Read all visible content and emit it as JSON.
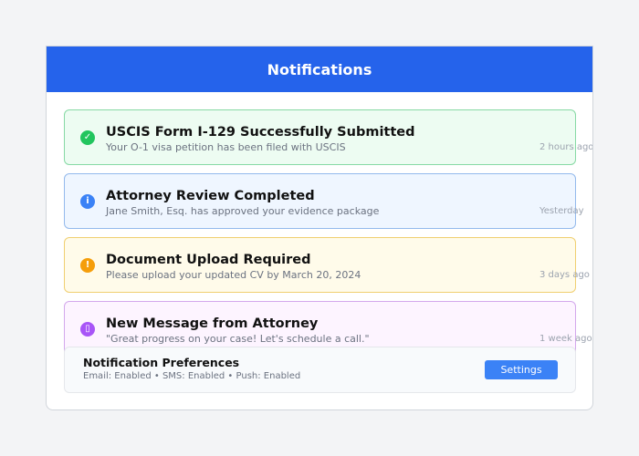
{
  "header": {
    "title": "Notifications"
  },
  "notifications": [
    {
      "title": "USCIS Form I-129 Successfully Submitted",
      "description": "Your O-1 visa petition has been filed with USCIS",
      "time": "2 hours ago",
      "icon": "check-icon",
      "icon_glyph": "✓",
      "bg": "#edfcf2",
      "border": "#86d9a4",
      "icon_color": "#22c55e"
    },
    {
      "title": "Attorney Review Completed",
      "description": "Jane Smith, Esq. has approved your evidence package",
      "time": "Yesterday",
      "icon": "info-icon",
      "icon_glyph": "i",
      "bg": "#eff6ff",
      "border": "#93b9ec",
      "icon_color": "#3b82f6"
    },
    {
      "title": "Document Upload Required",
      "description": "Please upload your updated CV by March 20, 2024",
      "time": "3 days ago",
      "icon": "warning-icon",
      "icon_glyph": "!",
      "bg": "#fffbea",
      "border": "#f0cf70",
      "icon_color": "#f59e0b"
    },
    {
      "title": "New Message from Attorney",
      "description": "\"Great progress on your case! Let's schedule a call.\"",
      "time": "1 week ago",
      "icon": "message-icon",
      "icon_glyph": "▯",
      "bg": "#fdf4ff",
      "border": "#d3a8ec",
      "icon_color": "#a855f7"
    }
  ],
  "preferences": {
    "title": "Notification Preferences",
    "status": "Email: Enabled • SMS: Enabled • Push: Enabled",
    "settings_label": "Settings"
  }
}
